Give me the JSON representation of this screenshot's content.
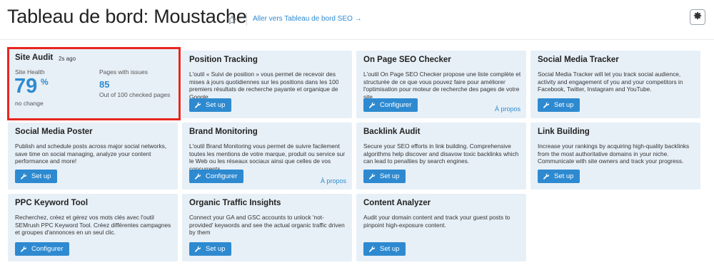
{
  "header": {
    "title": "Tableau de bord: Moustache",
    "seo_link": "Aller vers Tableau de bord SEO →"
  },
  "site_audit": {
    "title": "Site Audit",
    "time": "2s ago",
    "health_label": "Site Health",
    "health_value": "79",
    "health_unit": "%",
    "health_change": "no change",
    "issues_label": "Pages with issues",
    "issues_value": "85",
    "issues_sub": "Out of 100 checked pages"
  },
  "cards": {
    "position_tracking": {
      "title": "Position Tracking",
      "desc": "L'outil « Suivi de position » vous permet de recevoir des mises à jours quotidiennes sur les positions dans les 100 premiers résultats de recherche payante et organique de Google.",
      "button": "Set up"
    },
    "on_page": {
      "title": "On Page SEO Checker",
      "desc": "L'outil On Page SEO Checker propose une liste complète et structurée de ce que vous pouvez faire pour améliorer l'optimisation pour moteur de recherche des pages de votre site.",
      "button": "Configurer",
      "link": "À propos"
    },
    "social_tracker": {
      "title": "Social Media Tracker",
      "desc": "Social Media Tracker will let you track social audience, activity and engagement of you and your competitors in Facebook, Twitter, Instagram and YouTube.",
      "button": "Set up"
    },
    "social_poster": {
      "title": "Social Media Poster",
      "desc": "Publish and schedule posts across major social networks, save time on social managing, analyze your content performance and more!",
      "button": "Set up"
    },
    "brand_monitoring": {
      "title": "Brand Monitoring",
      "desc": "L'outil Brand Monitoring vous permet de suivre facilement toutes les mentions de votre marque, produit ou service sur le Web ou les réseaux sociaux ainsi que celles de vos concurrents.",
      "button": "Configurer",
      "link": "À propos"
    },
    "backlink_audit": {
      "title": "Backlink Audit",
      "desc": "Secure your SEO efforts in link building. Comprehensive algorithms help discover and disavow toxic backlinks which can lead to penalties by search engines.",
      "button": "Set up"
    },
    "link_building": {
      "title": "Link Building",
      "desc": "Increase your rankings by acquiring high-quality backlinks from the most authoritative domains in your niche. Communicate with site owners and track your progress.",
      "button": "Set up"
    },
    "ppc": {
      "title": "PPC Keyword Tool",
      "desc": "Recherchez, créez et gérez vos mots clés avec l'outil SEMrush PPC Keyword Tool. Créez différentes campagnes et groupes d'annonces en un seul clic.",
      "button": "Configurer"
    },
    "organic_traffic": {
      "title": "Organic Traffic Insights",
      "desc": "Connect your GA and GSC accounts to unlock 'not-provided' keywords and see the actual organic traffic driven by them",
      "button": "Set up"
    },
    "content_analyzer": {
      "title": "Content Analyzer",
      "desc": "Audit your domain content and track your guest posts to pinpoint high-exposure content.",
      "button": "Set up"
    }
  },
  "icons": {
    "star": "star-icon",
    "gear": "gear-icon",
    "wrench": "wrench-icon"
  },
  "colors": {
    "accent": "#2e8ad0",
    "card_bg": "#e7f0f7",
    "highlight_border": "#e8261f"
  }
}
